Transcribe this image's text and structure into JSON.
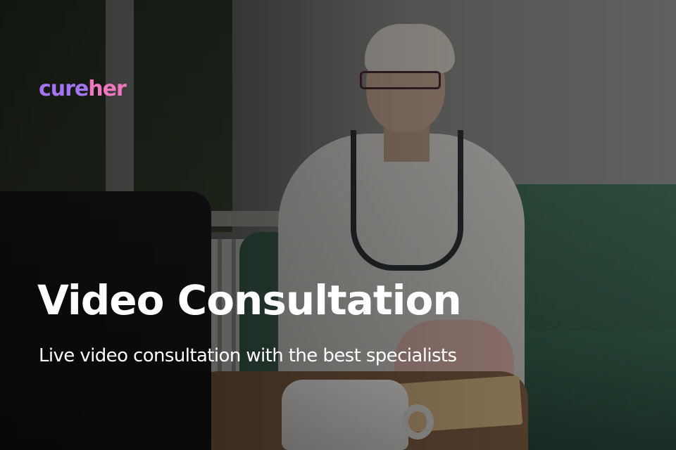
{
  "brand": {
    "logo_part1": "cure",
    "logo_part2": "her",
    "color_part1": "#a574f2",
    "color_part2": "#ee77c0"
  },
  "hero": {
    "title": "Video Consultation",
    "subtitle": "Live video consultation with the best specialists"
  }
}
